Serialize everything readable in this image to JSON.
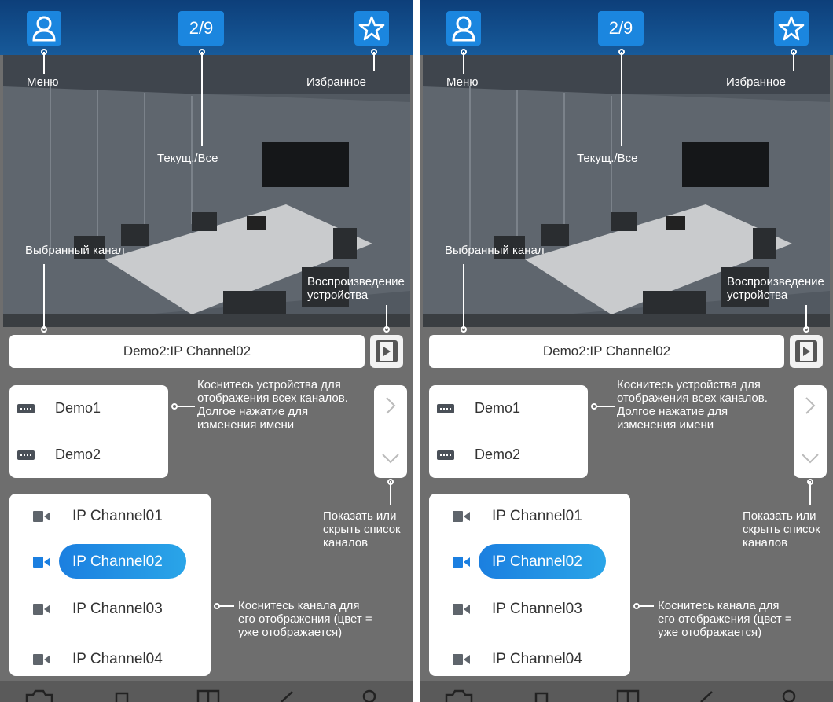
{
  "panels": [
    {
      "id": "left",
      "header": {
        "page_counter": "2/9"
      },
      "labels": {
        "menu": "Меню",
        "favorites": "Избранное",
        "current_all": "Текущ./Все",
        "selected_channel": "Выбранный канал",
        "device_playback_1": "Воспроизведение",
        "device_playback_2": "устройства",
        "device_tip_1": "Коснитесь устройства для",
        "device_tip_2": "отображения всех каналов.",
        "device_tip_3": "Долгое нажатие для",
        "device_tip_4": "изменения имени",
        "toggle_tip_1": "Показать или",
        "toggle_tip_2": "скрыть список",
        "toggle_tip_3": "каналов",
        "channel_tip_1": "Коснитесь канала для",
        "channel_tip_2": "его отображения (цвет =",
        "channel_tip_3": "уже отображается)"
      },
      "selected_channel": "Demo2:IP Channel02",
      "devices": [
        "Demo1",
        "Demo2"
      ],
      "channels": [
        "IP Channel01",
        "IP Channel02",
        "IP Channel03",
        "IP Channel04"
      ]
    },
    {
      "id": "right",
      "header": {
        "page_counter": "2/9"
      },
      "labels": {
        "menu": "Меню",
        "favorites": "Избранное",
        "current_all": "Текущ./Все",
        "selected_channel": "Выбранный канал",
        "device_playback_1": "Воспроизведение",
        "device_playback_2": "устройства",
        "device_tip_1": "Коснитесь устройства для",
        "device_tip_2": "отображения всех каналов.",
        "device_tip_3": "Долгое нажатие для",
        "device_tip_4": "изменения имени",
        "toggle_tip_1": "Показать или",
        "toggle_tip_2": "скрыть список",
        "toggle_tip_3": "каналов",
        "channel_tip_1": "Коснитесь канала для",
        "channel_tip_2": "его отображения (цвет =",
        "channel_tip_3": "уже отображается)"
      },
      "selected_channel": "Demo2:IP Channel02",
      "devices": [
        "Demo1",
        "Demo2"
      ],
      "channels": [
        "IP Channel01",
        "IP Channel02",
        "IP Channel03",
        "IP Channel04"
      ]
    }
  ],
  "colors": {
    "accent": "#1b86df",
    "header_bg": "#0d3f7a",
    "panel_bg": "#6e6e6e",
    "selected_pill": "#1b7fe0"
  },
  "icons": {
    "menu": "user-icon",
    "favorites": "star-icon",
    "playback": "film-play-icon",
    "device": "dvr-device-icon",
    "channel": "camera-icon",
    "expand": "chevron-right-icon",
    "collapse": "chevron-down-icon"
  }
}
